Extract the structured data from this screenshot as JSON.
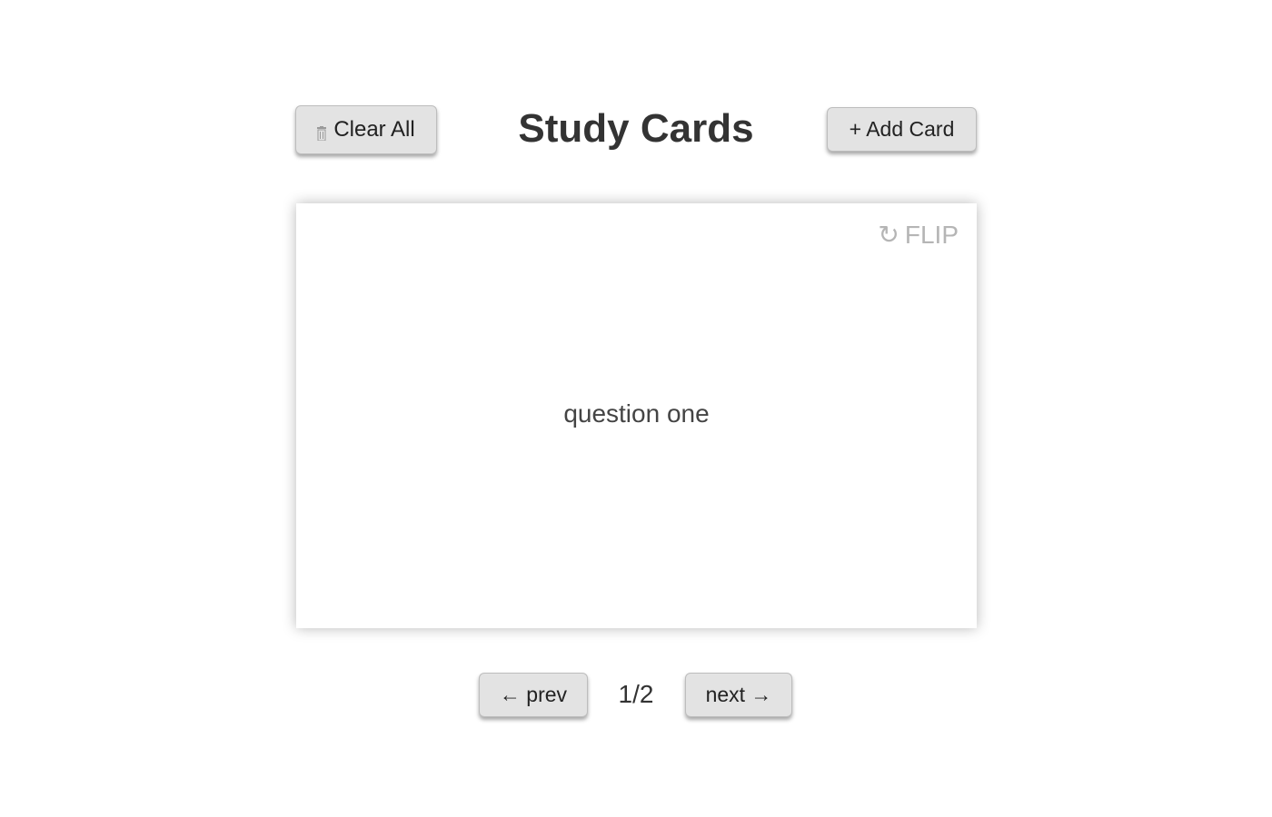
{
  "header": {
    "title": "Study Cards",
    "clear_label": "Clear All",
    "clear_icon": "trash-icon",
    "add_label": "+ Add Card"
  },
  "card": {
    "flip_label": "FLIP",
    "flip_icon": "↻",
    "text": "question one"
  },
  "nav": {
    "prev_label": "← prev",
    "next_label": "next →",
    "counter": "1/2"
  },
  "colors": {
    "button_bg": "#e3e3e3",
    "flip_text": "#b5b5b5",
    "title_text": "#333333"
  }
}
